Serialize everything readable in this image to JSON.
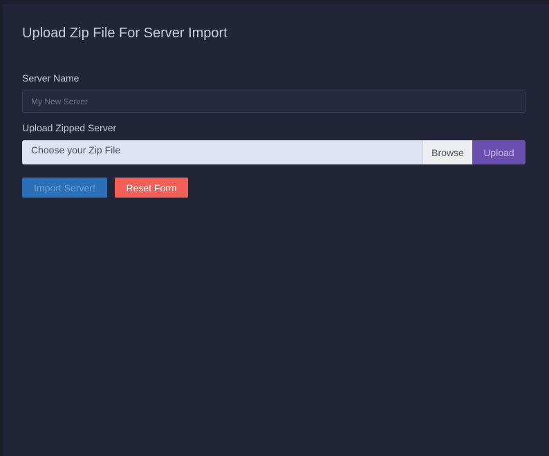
{
  "form": {
    "title": "Upload Zip File For Server Import",
    "server_name_label": "Server Name",
    "server_name_placeholder": "My New Server",
    "server_name_value": "",
    "upload_label": "Upload Zipped Server",
    "file_placeholder": "Choose your Zip File",
    "browse_label": "Browse",
    "upload_button": "Upload",
    "import_button": "Import Server!",
    "reset_button": "Reset Form"
  },
  "colors": {
    "background": "#222437",
    "import": "#2a6fb8",
    "reset": "#f15f56",
    "upload": "#6b4fb0"
  }
}
